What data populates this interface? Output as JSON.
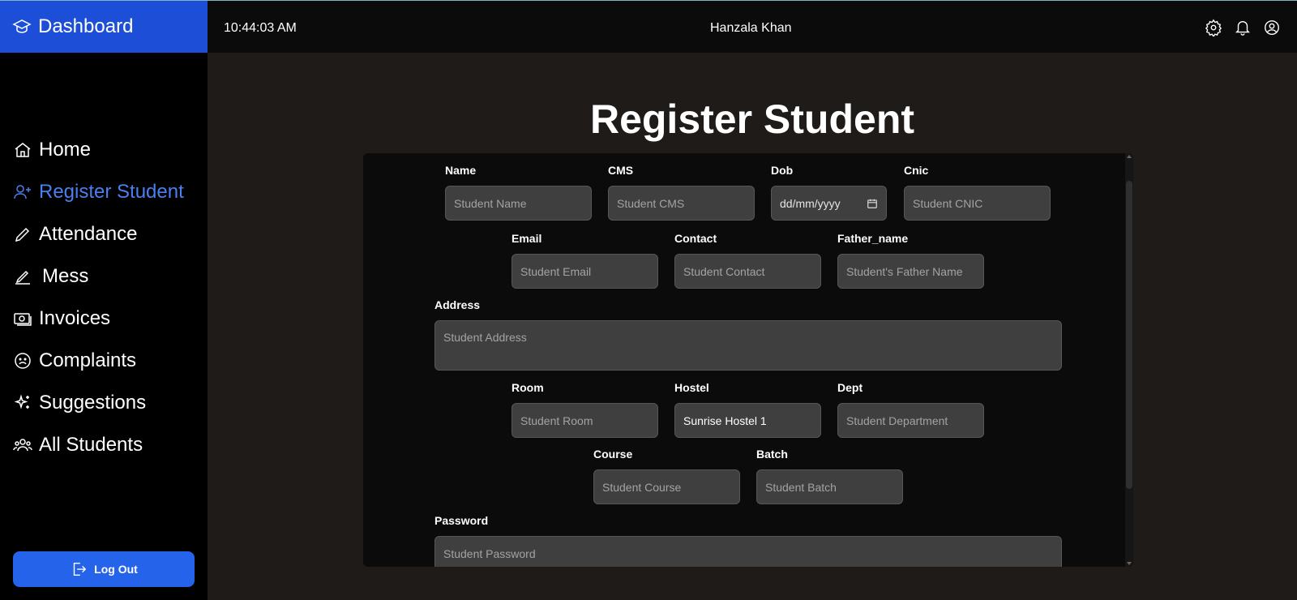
{
  "sidebar": {
    "brand": "Dashboard",
    "items": [
      {
        "label": "Home"
      },
      {
        "label": "Register Student"
      },
      {
        "label": "Attendance"
      },
      {
        "label": "Mess"
      },
      {
        "label": "Invoices"
      },
      {
        "label": "Complaints"
      },
      {
        "label": "Suggestions"
      },
      {
        "label": "All Students"
      }
    ],
    "logout": "Log Out"
  },
  "topbar": {
    "time": "10:44:03 AM",
    "user": "Hanzala Khan"
  },
  "page": {
    "title": "Register Student"
  },
  "form": {
    "name": {
      "label": "Name",
      "placeholder": "Student Name"
    },
    "cms": {
      "label": "CMS",
      "placeholder": "Student CMS"
    },
    "dob": {
      "label": "Dob",
      "placeholder": "dd/mm/yyyy"
    },
    "cnic": {
      "label": "Cnic",
      "placeholder": "Student CNIC"
    },
    "email": {
      "label": "Email",
      "placeholder": "Student Email"
    },
    "contact": {
      "label": "Contact",
      "placeholder": "Student Contact"
    },
    "father_name": {
      "label": "Father_name",
      "placeholder": "Student's Father Name"
    },
    "address": {
      "label": "Address",
      "placeholder": "Student Address"
    },
    "room": {
      "label": "Room",
      "placeholder": "Student Room"
    },
    "hostel": {
      "label": "Hostel",
      "value": "Sunrise Hostel 1"
    },
    "dept": {
      "label": "Dept",
      "placeholder": "Student Department"
    },
    "course": {
      "label": "Course",
      "placeholder": "Student Course"
    },
    "batch": {
      "label": "Batch",
      "placeholder": "Student Batch"
    },
    "password": {
      "label": "Password",
      "placeholder": "Student Password"
    }
  },
  "colors": {
    "brand": "#1d4ed8",
    "active_nav": "#4a7ff0",
    "logout": "#2563eb",
    "background": "#1f1b18",
    "card": "#0b0b0b",
    "input": "#3f3f3f"
  },
  "icons": [
    "graduation-cap-icon",
    "home-icon",
    "user-plus-icon",
    "pencil-icon",
    "pen-icon",
    "banknote-icon",
    "frown-icon",
    "sparkles-icon",
    "users-icon",
    "logout-icon",
    "gear-icon",
    "bell-icon",
    "user-circle-icon",
    "calendar-icon"
  ]
}
